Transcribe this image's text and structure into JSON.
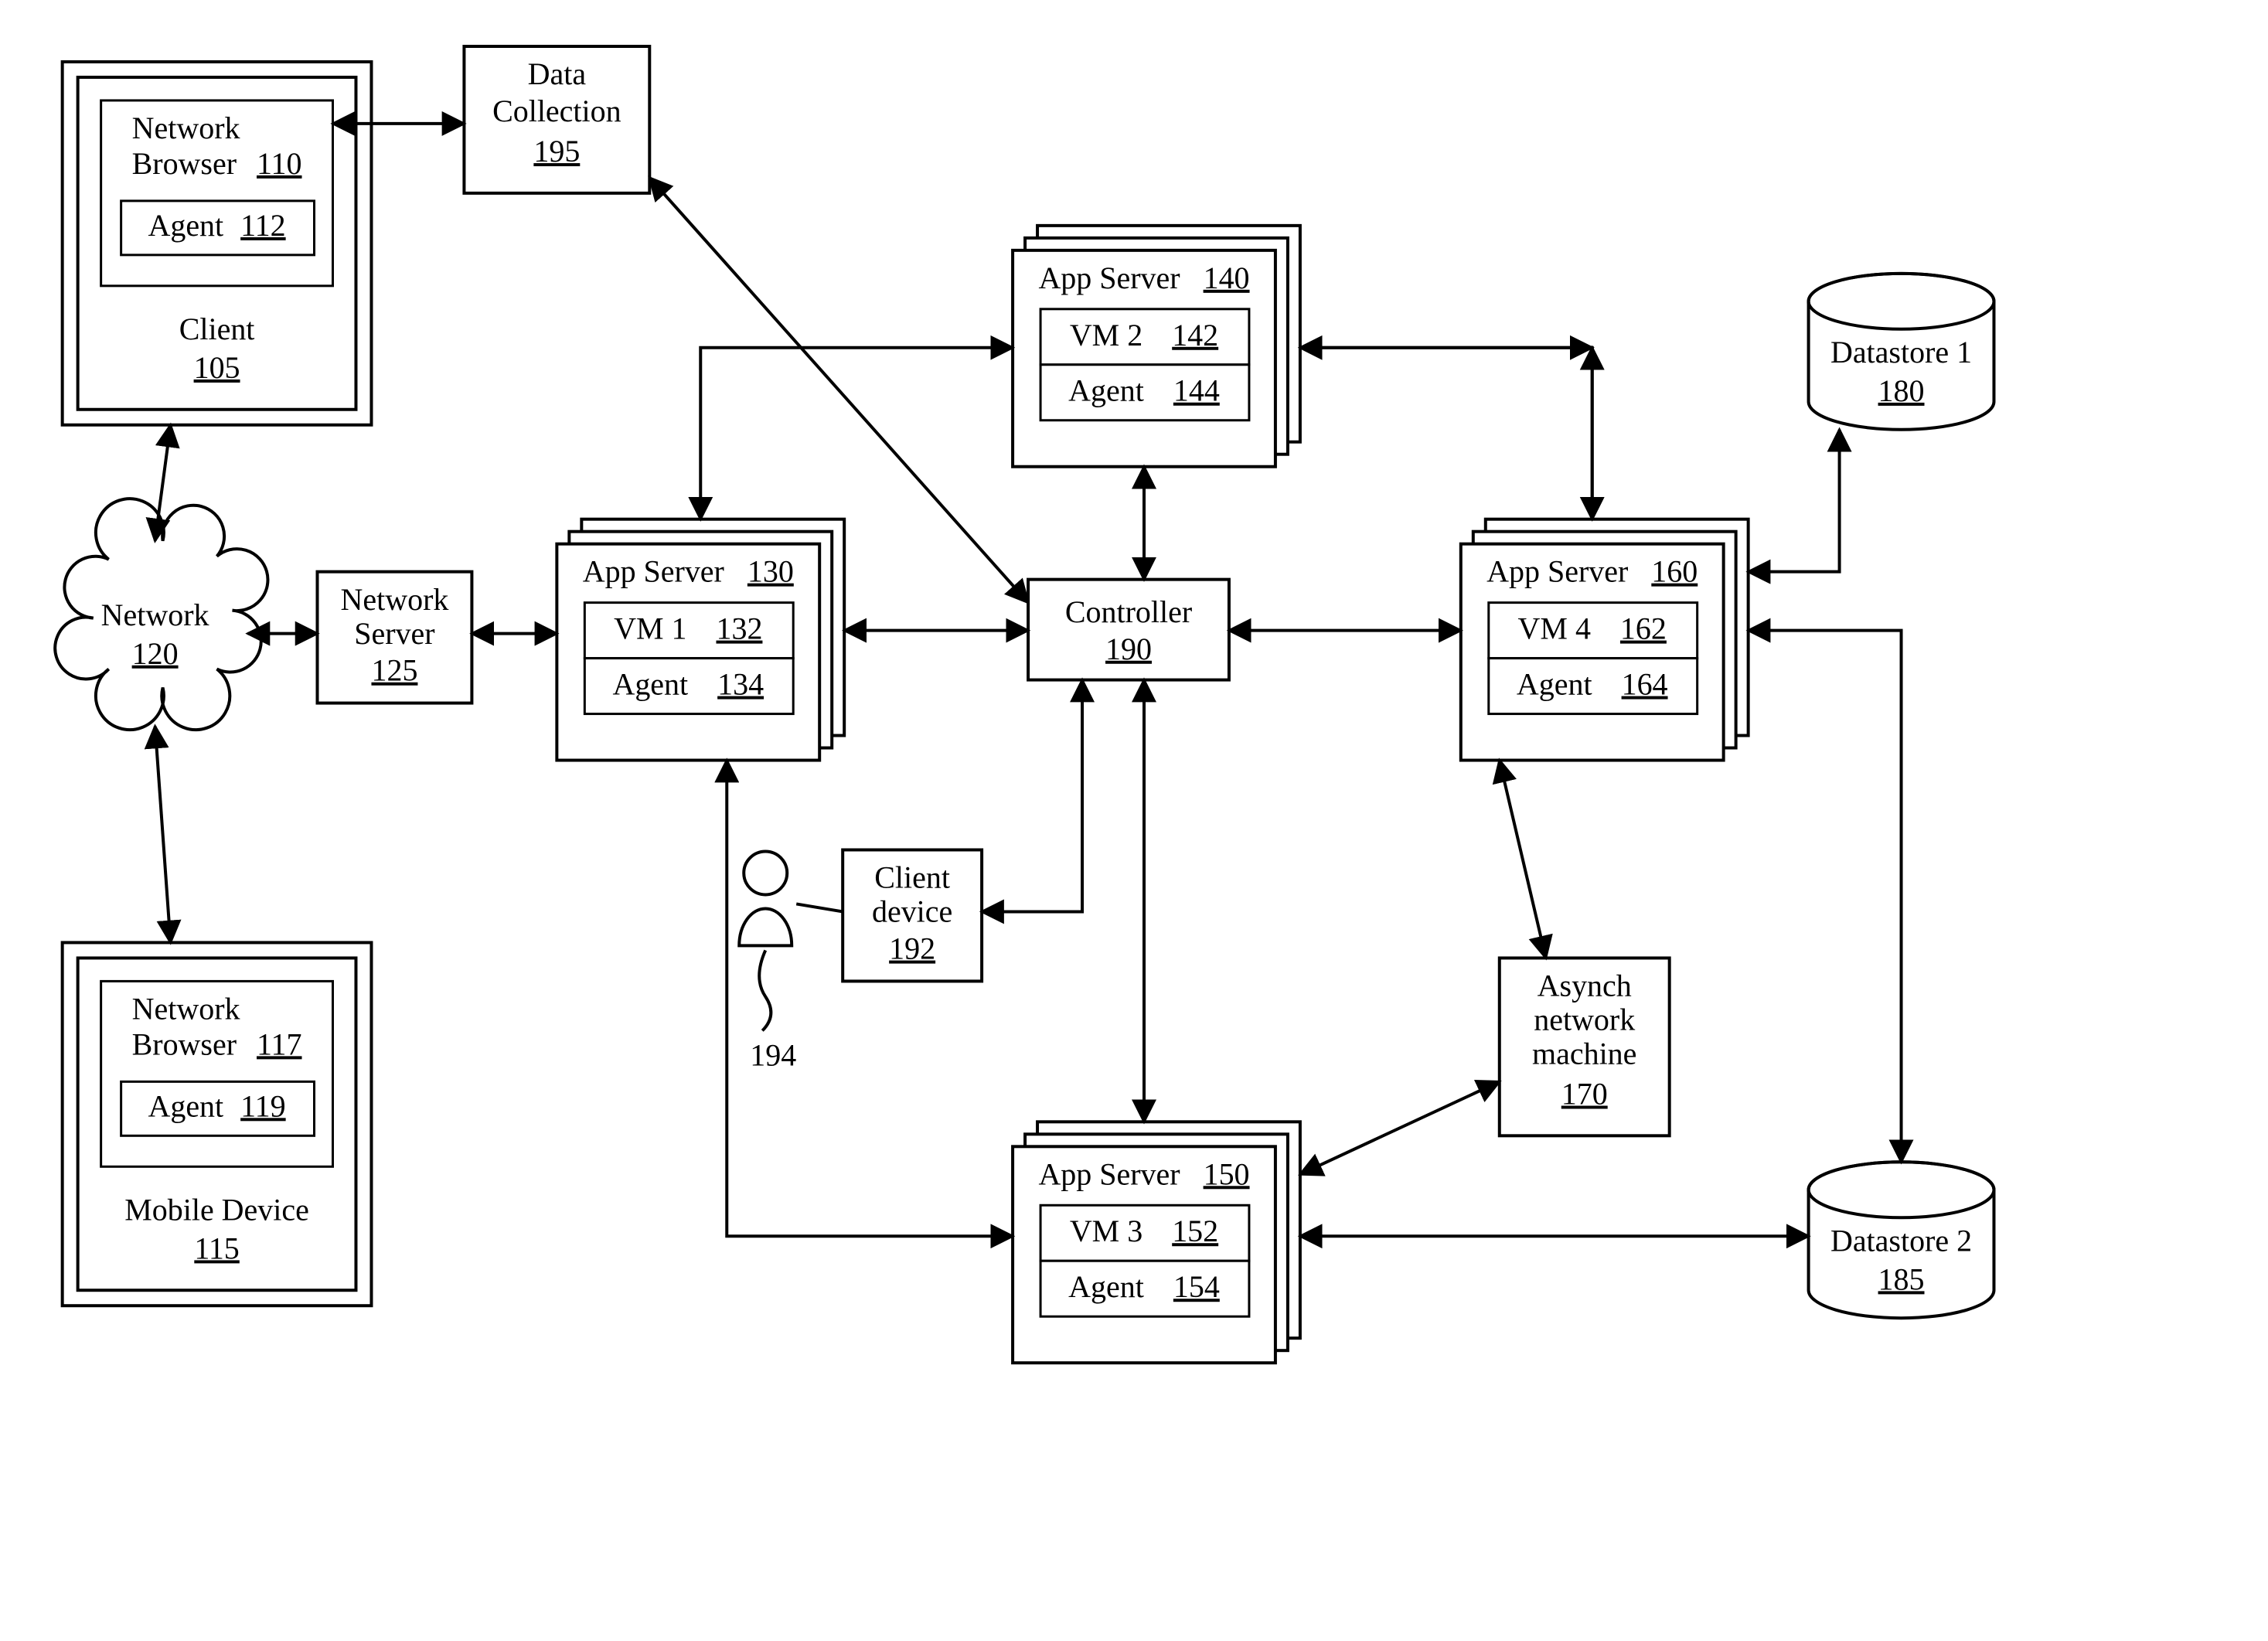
{
  "client": {
    "browser_label": "Network",
    "browser_label2": "Browser",
    "browser_ref": "110",
    "agent_label": "Agent",
    "agent_ref": "112",
    "label": "Client",
    "ref": "105"
  },
  "mobile": {
    "browser_label": "Network",
    "browser_label2": "Browser",
    "browser_ref": "117",
    "agent_label": "Agent",
    "agent_ref": "119",
    "label": "Mobile Device",
    "ref": "115"
  },
  "network": {
    "label": "Network",
    "ref": "120"
  },
  "network_server": {
    "label": "Network",
    "label2": "Server",
    "ref": "125"
  },
  "data_collection": {
    "label": "Data",
    "label2": "Collection",
    "ref": "195"
  },
  "app_servers": {
    "a130": {
      "label": "App Server",
      "ref": "130",
      "vm_label": "VM 1",
      "vm_ref": "132",
      "agent_label": "Agent",
      "agent_ref": "134"
    },
    "a140": {
      "label": "App Server",
      "ref": "140",
      "vm_label": "VM 2",
      "vm_ref": "142",
      "agent_label": "Agent",
      "agent_ref": "144"
    },
    "a150": {
      "label": "App Server",
      "ref": "150",
      "vm_label": "VM 3",
      "vm_ref": "152",
      "agent_label": "Agent",
      "agent_ref": "154"
    },
    "a160": {
      "label": "App Server",
      "ref": "160",
      "vm_label": "VM 4",
      "vm_ref": "162",
      "agent_label": "Agent",
      "agent_ref": "164"
    }
  },
  "controller": {
    "label": "Controller",
    "ref": "190"
  },
  "client_device": {
    "label": "Client",
    "label2": "device",
    "ref": "192"
  },
  "user": {
    "ref": "194"
  },
  "asynch": {
    "label": "Asynch",
    "label2": "network",
    "label3": "machine",
    "ref": "170"
  },
  "datastore1": {
    "label": "Datastore 1",
    "ref": "180"
  },
  "datastore2": {
    "label": "Datastore 2",
    "ref": "185"
  }
}
